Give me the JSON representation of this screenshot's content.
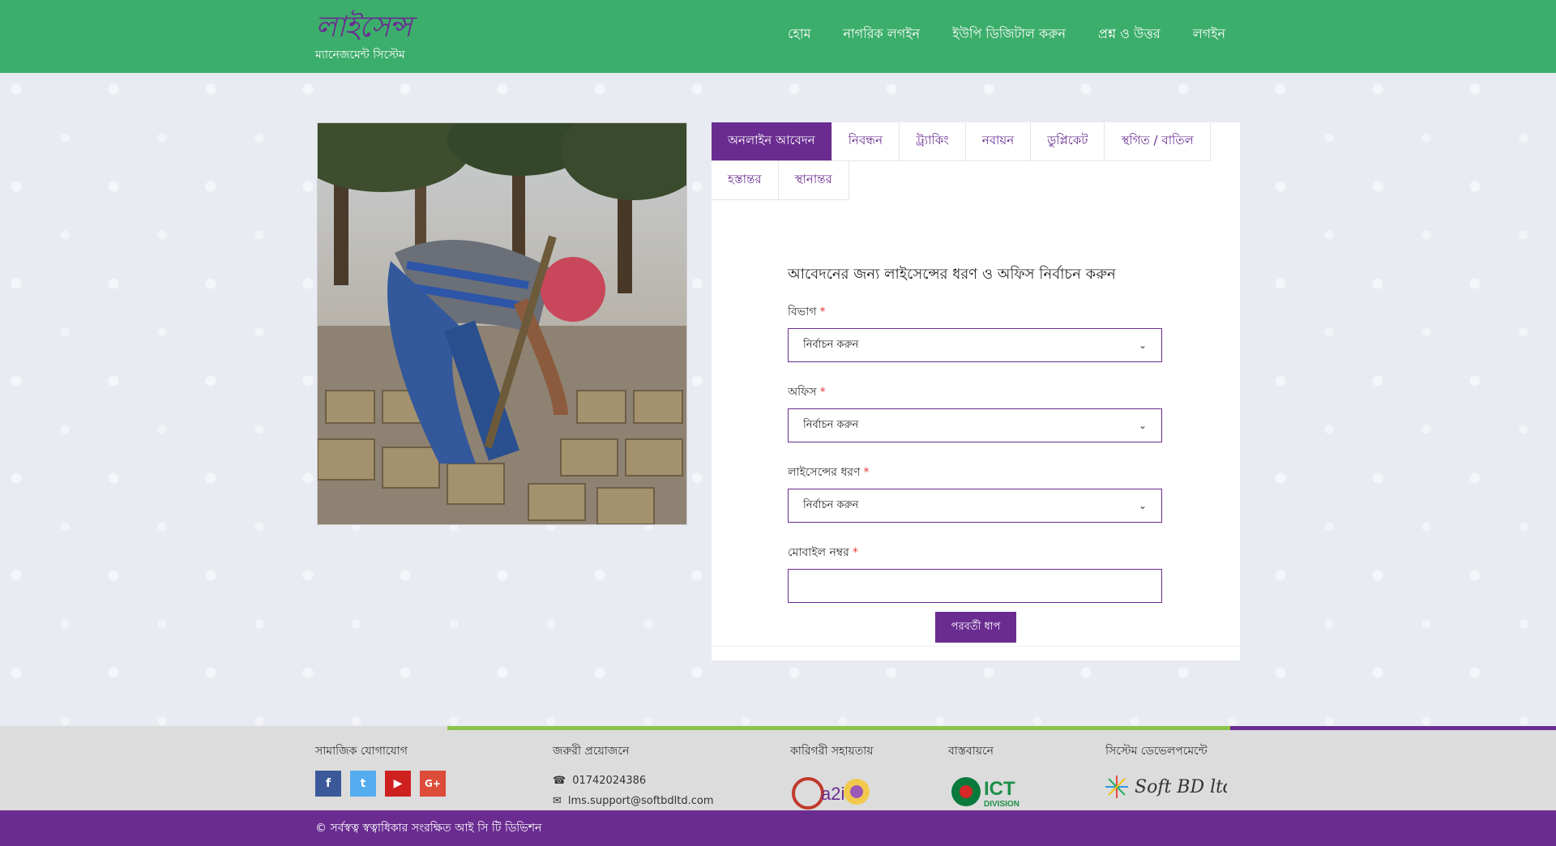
{
  "header": {
    "logo_script": "লাইসেন্স",
    "logo_sub": "ম্যানেজমেন্ট সিস্টেম",
    "nav": [
      "হোম",
      "নাগরিক লগইন",
      "ইউপি ডিজিটাল করুন",
      "প্রশ্ন ও উত্তর",
      "লগইন"
    ]
  },
  "tabs": [
    "অনলাইন আবেদন",
    "নিবন্ধন",
    "ট্র্যাকিং",
    "নবায়ন",
    "ডুপ্লিকেট",
    "স্থগিত / বাতিল",
    "হস্তান্তর",
    "স্থানান্তর"
  ],
  "form": {
    "title": "আবেদনের জন্য লাইসেন্সের ধরণ ও অফিস নির্বাচন করুন",
    "required_mark": "*",
    "division_label": "বিভাগ",
    "division_value": "নির্বাচন করুন",
    "office_label": "অফিস",
    "office_value": "নির্বাচন করুন",
    "license_type_label": "লাইসেন্সের ধরণ",
    "license_type_value": "নির্বাচন করুন",
    "mobile_label": "মোবাইল নম্বর",
    "mobile_value": "",
    "next_button": "পরবর্তী ধাপ"
  },
  "footer": {
    "social_title": "সামাজিক যোগাযোগ",
    "social": [
      "f",
      "t",
      "▶",
      "G+"
    ],
    "emergency_title": "জরুরী প্রয়োজনে",
    "phone": "01742024386",
    "email": "lms.support@softbdltd.com",
    "tech_title": "কারিগরী সহায়তায়",
    "impl_title": "বাস্তবায়নে",
    "dev_title": "সিস্টেম ডেভেলপমেন্টে",
    "a2i_text": "a2i",
    "ict_text": "ICT",
    "ict_sub": "DIVISION",
    "softbd_text": "Soft BD ltd.",
    "copyright": "© সর্বস্বত্ব স্বত্বাধিকার সংরক্ষিত আই সি টি ডিভিশন"
  },
  "colors": {
    "header_green": "#3cae6b",
    "brand_purple": "#6a2c91",
    "facebook": "#3b5998",
    "twitter": "#55acee",
    "youtube": "#cd201f",
    "google": "#dd4b39"
  }
}
